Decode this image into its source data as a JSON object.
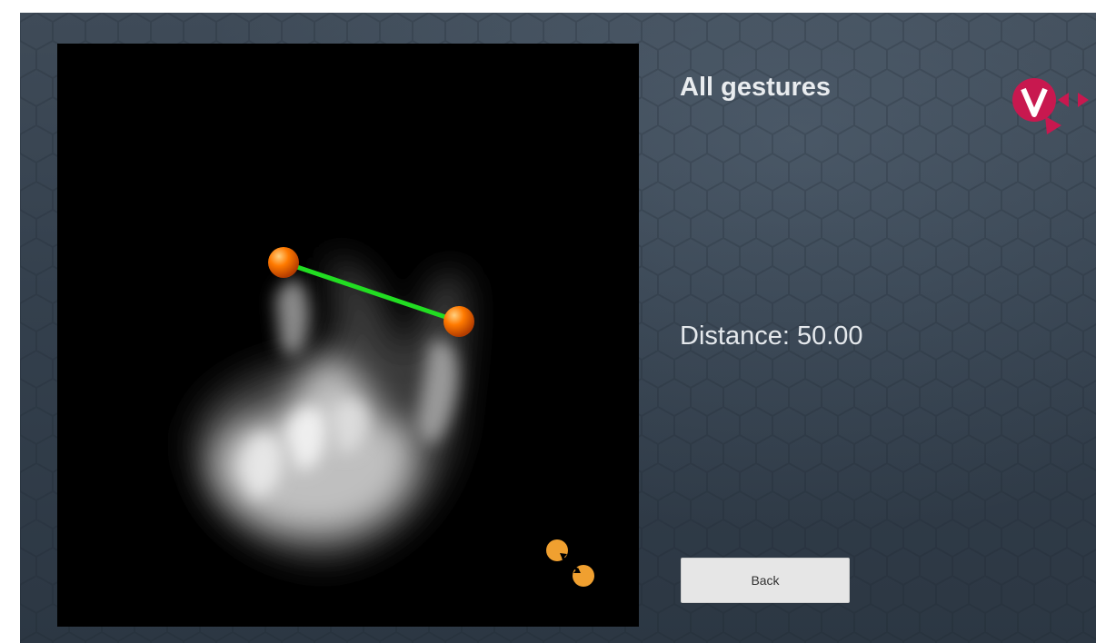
{
  "screen": {
    "title": "All gestures",
    "distance_label": "Distance:",
    "distance_value": "50.00",
    "distance_text": "Distance: 50.00",
    "back_label": "Back"
  },
  "logo": {
    "letter": "V",
    "color": "#c8184f"
  },
  "camera": {
    "marker_color": "#ff7a00",
    "line_color": "#22dd22",
    "gesture_icon_color": "#f0a030"
  },
  "icons": [
    "hand-tracking-point-icon",
    "pinch-distance-gesture-icon",
    "brand-logo-icon"
  ]
}
